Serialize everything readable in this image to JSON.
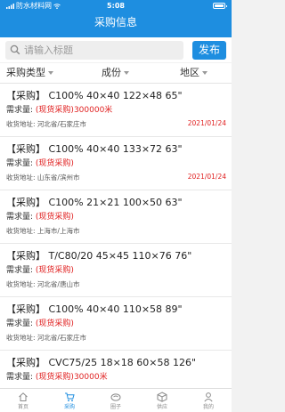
{
  "status": {
    "carrier": "防水材料网",
    "time": "5:08"
  },
  "header": {
    "title": "采购信息"
  },
  "search": {
    "placeholder": "请输入标题",
    "publish_label": "发布"
  },
  "filters": [
    "采购类型",
    "成份",
    "地区"
  ],
  "items": [
    {
      "title": "【采购】 C100% 40×40 122×48 65\"",
      "req_label": "需求量:",
      "req_value": "(现货采购)300000米",
      "addr_label": "收货地址:",
      "addr_value": "河北省/石家庄市",
      "date": "2021/01/24"
    },
    {
      "title": "【采购】 C100% 40×40 133×72 63\"",
      "req_label": "需求量:",
      "req_value": "(现货采购)",
      "addr_label": "收货地址:",
      "addr_value": "山东省/滨州市",
      "date": "2021/01/24"
    },
    {
      "title": "【采购】 C100% 21×21 100×50 63\"",
      "req_label": "需求量:",
      "req_value": "(现货采购)",
      "addr_label": "收货地址:",
      "addr_value": "上海市/上海市",
      "date": ""
    },
    {
      "title": "【采购】 T/C80/20 45×45 110×76 76\"",
      "req_label": "需求量:",
      "req_value": "(现货采购)",
      "addr_label": "收货地址:",
      "addr_value": "河北省/唐山市",
      "date": ""
    },
    {
      "title": "【采购】 C100% 40×40 110×58 89\"",
      "req_label": "需求量:",
      "req_value": "(现货采购)",
      "addr_label": "收货地址:",
      "addr_value": "河北省/石家庄市",
      "date": ""
    },
    {
      "title": "【采购】 CVC75/25 18×18 60×58 126\"",
      "req_label": "需求量:",
      "req_value": "(现货采购)30000米",
      "addr_label": "",
      "addr_value": "",
      "date": ""
    }
  ],
  "tabs": [
    {
      "label": "首页",
      "icon": "home-icon"
    },
    {
      "label": "采购",
      "icon": "cart-icon",
      "active": true
    },
    {
      "label": "圈子",
      "icon": "circle-icon"
    },
    {
      "label": "供应",
      "icon": "box-icon"
    },
    {
      "label": "我的",
      "icon": "user-icon"
    }
  ],
  "colors": {
    "brand": "#1e8ee0",
    "accent_red": "#e02020"
  }
}
